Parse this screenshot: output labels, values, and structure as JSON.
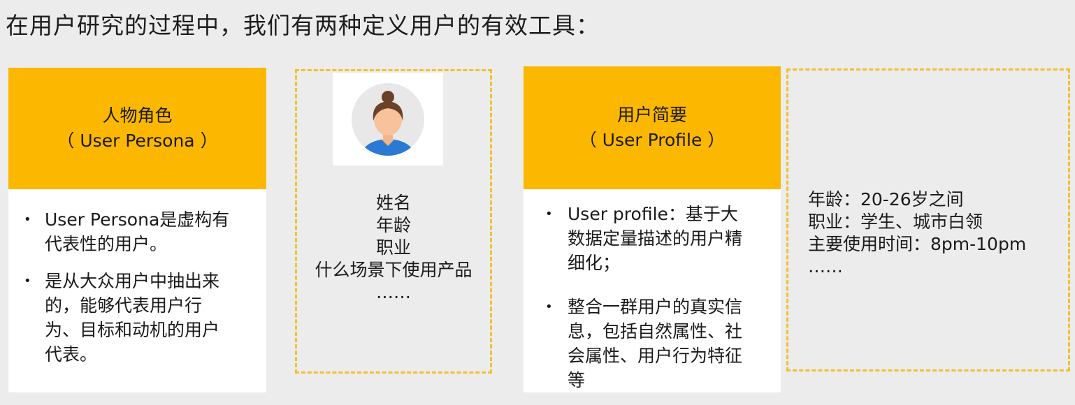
{
  "title": "在用户研究的过程中，我们有两种定义用户的有效工具：",
  "colors": {
    "accent": "#fcb700",
    "dashed_border": "#f2c02e",
    "background": "#ececec"
  },
  "persona_card": {
    "heading_line1": "人物角色",
    "heading_line2": "（ User  Persona ）",
    "bullets": [
      {
        "text_lines": [
          "User Persona是虚构有",
          "代表性的用户。"
        ]
      },
      {
        "text_lines": [
          "是从大众用户中抽出来",
          "的，能够代表用户行",
          "为、目标和动机的用户",
          "代表。"
        ]
      }
    ]
  },
  "persona_example": {
    "avatar_icon": "user-avatar-icon",
    "lines": [
      "姓名",
      "年龄",
      "职业",
      "什么场景下使用产品",
      "……"
    ]
  },
  "profile_card": {
    "heading_line1": "用户简要",
    "heading_line2": "（ User Profile ）",
    "bullets": [
      {
        "text_lines": [
          "User profile：基于大",
          "数据定量描述的用户精",
          "细化；"
        ]
      },
      {
        "text_lines": [
          "整合一群用户的真实信",
          "息，包括自然属性、社",
          "会属性、用户行为特征",
          "等"
        ]
      }
    ]
  },
  "profile_example": {
    "lines": [
      "年龄：20-26岁之间",
      "职业：学生、城市白领",
      "主要使用时间：8pm-10pm",
      "……"
    ]
  }
}
